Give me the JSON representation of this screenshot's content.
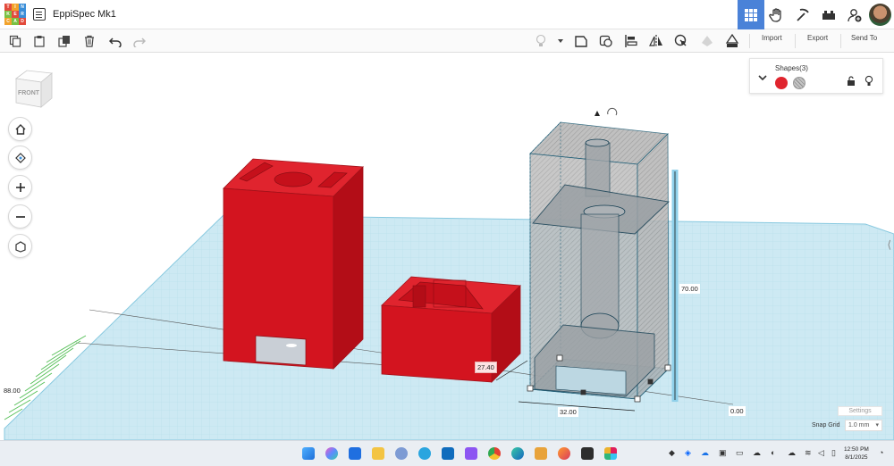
{
  "app": {
    "logo_letters": [
      "T",
      "I",
      "N",
      "K",
      "E",
      "R",
      "C",
      "A",
      "D"
    ],
    "logo_colors": [
      "#e24a3b",
      "#f2a32c",
      "#3a8ed8",
      "#7ac143",
      "#e24a3b",
      "#3a8ed8",
      "#f2a32c",
      "#7ac143",
      "#e24a3b"
    ],
    "document_title": "EppiSpec Mk1"
  },
  "header_icons": [
    "grid-view-icon",
    "hand-icon",
    "pickaxe-icon",
    "lego-brick-icon",
    "add-user-icon"
  ],
  "toolbar": {
    "left_tools": [
      "copy-icon",
      "paste-icon",
      "duplicate-icon",
      "delete-icon",
      "undo-icon",
      "redo-icon"
    ],
    "right_tools": [
      "light-bulb-icon",
      "shape-note-icon",
      "workplane-icon",
      "align-icon",
      "mirror-icon",
      "group-icon",
      "ungroup-icon",
      "ruler-icon"
    ],
    "import_label": "Import",
    "export_label": "Export",
    "send_to_label": "Send To"
  },
  "viewcube": {
    "face_label": "FRONT"
  },
  "nav_buttons": [
    "home-view-icon",
    "fit-view-icon",
    "zoom-in-icon",
    "zoom-out-icon",
    "ortho-view-icon"
  ],
  "shapes_panel": {
    "title": "Shapes(3)",
    "solid_color": "#e0242e",
    "icons": [
      "collapse-chevron-icon",
      "solid-swatch-icon",
      "hole-swatch-icon",
      "lock-icon",
      "light-bulb-icon"
    ]
  },
  "dimensions": {
    "height": "70.00",
    "width": "32.00",
    "elevation": "0.00",
    "depth_label": "27.40",
    "ruler": "88.00"
  },
  "grid_controls": {
    "settings_label": "Settings",
    "snap_grid_label": "Snap Grid",
    "snap_grid_value": "1.0 mm"
  },
  "colors": {
    "shape_red": "#d3141f",
    "workplane": "#c7e9f4",
    "selection": "#56b7dc",
    "accent": "#4a82d8"
  },
  "taskbar": {
    "icons": [
      "windows-start-icon",
      "copilot-icon",
      "store-icon",
      "file-explorer-icon",
      "app-icon",
      "telegram-icon",
      "outlook-icon",
      "twitch-icon",
      "chrome-icon",
      "edge-icon",
      "folder-icon",
      "firefox-icon",
      "terminal-icon",
      "slack-icon"
    ],
    "tray_icons": [
      "tray-app-icon",
      "dropbox-icon",
      "onedrive-icon",
      "notification-icon",
      "battery-icon",
      "cloud-icon",
      "wifi-icon",
      "volume-icon",
      "power-icon"
    ],
    "time": "12:50 PM",
    "date": "8/1/2025"
  }
}
